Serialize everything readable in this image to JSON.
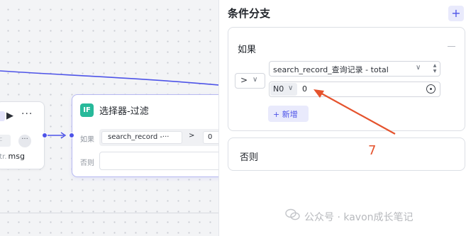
{
  "canvas": {
    "left_node": {
      "field_ghost": "ic",
      "str_type": "str.",
      "str_name": "msg"
    },
    "selector_node": {
      "badge": "IF",
      "title": "选择器-过滤",
      "if_label": "如果",
      "else_label": "否则",
      "cond_variable": "search_record -···",
      "cond_operator": ">",
      "cond_value": "0"
    }
  },
  "panel": {
    "title": "条件分支",
    "add_icon": "+",
    "if_card": {
      "label": "如果",
      "operator": ">",
      "variable": "search_record_查询记录",
      "variable_separator": " - ",
      "variable_field": "total",
      "value_type": "N0",
      "value": "0",
      "add_condition": "+ 新增"
    },
    "else_card": {
      "label": "否则"
    }
  },
  "annotation": {
    "number": "7",
    "color": "#e5532d"
  },
  "watermark": {
    "text": "公众号 · kavon成长笔记"
  },
  "colors": {
    "accent": "#4d53e8",
    "if_badge": "#27b99a",
    "annotation": "#e5532d"
  }
}
